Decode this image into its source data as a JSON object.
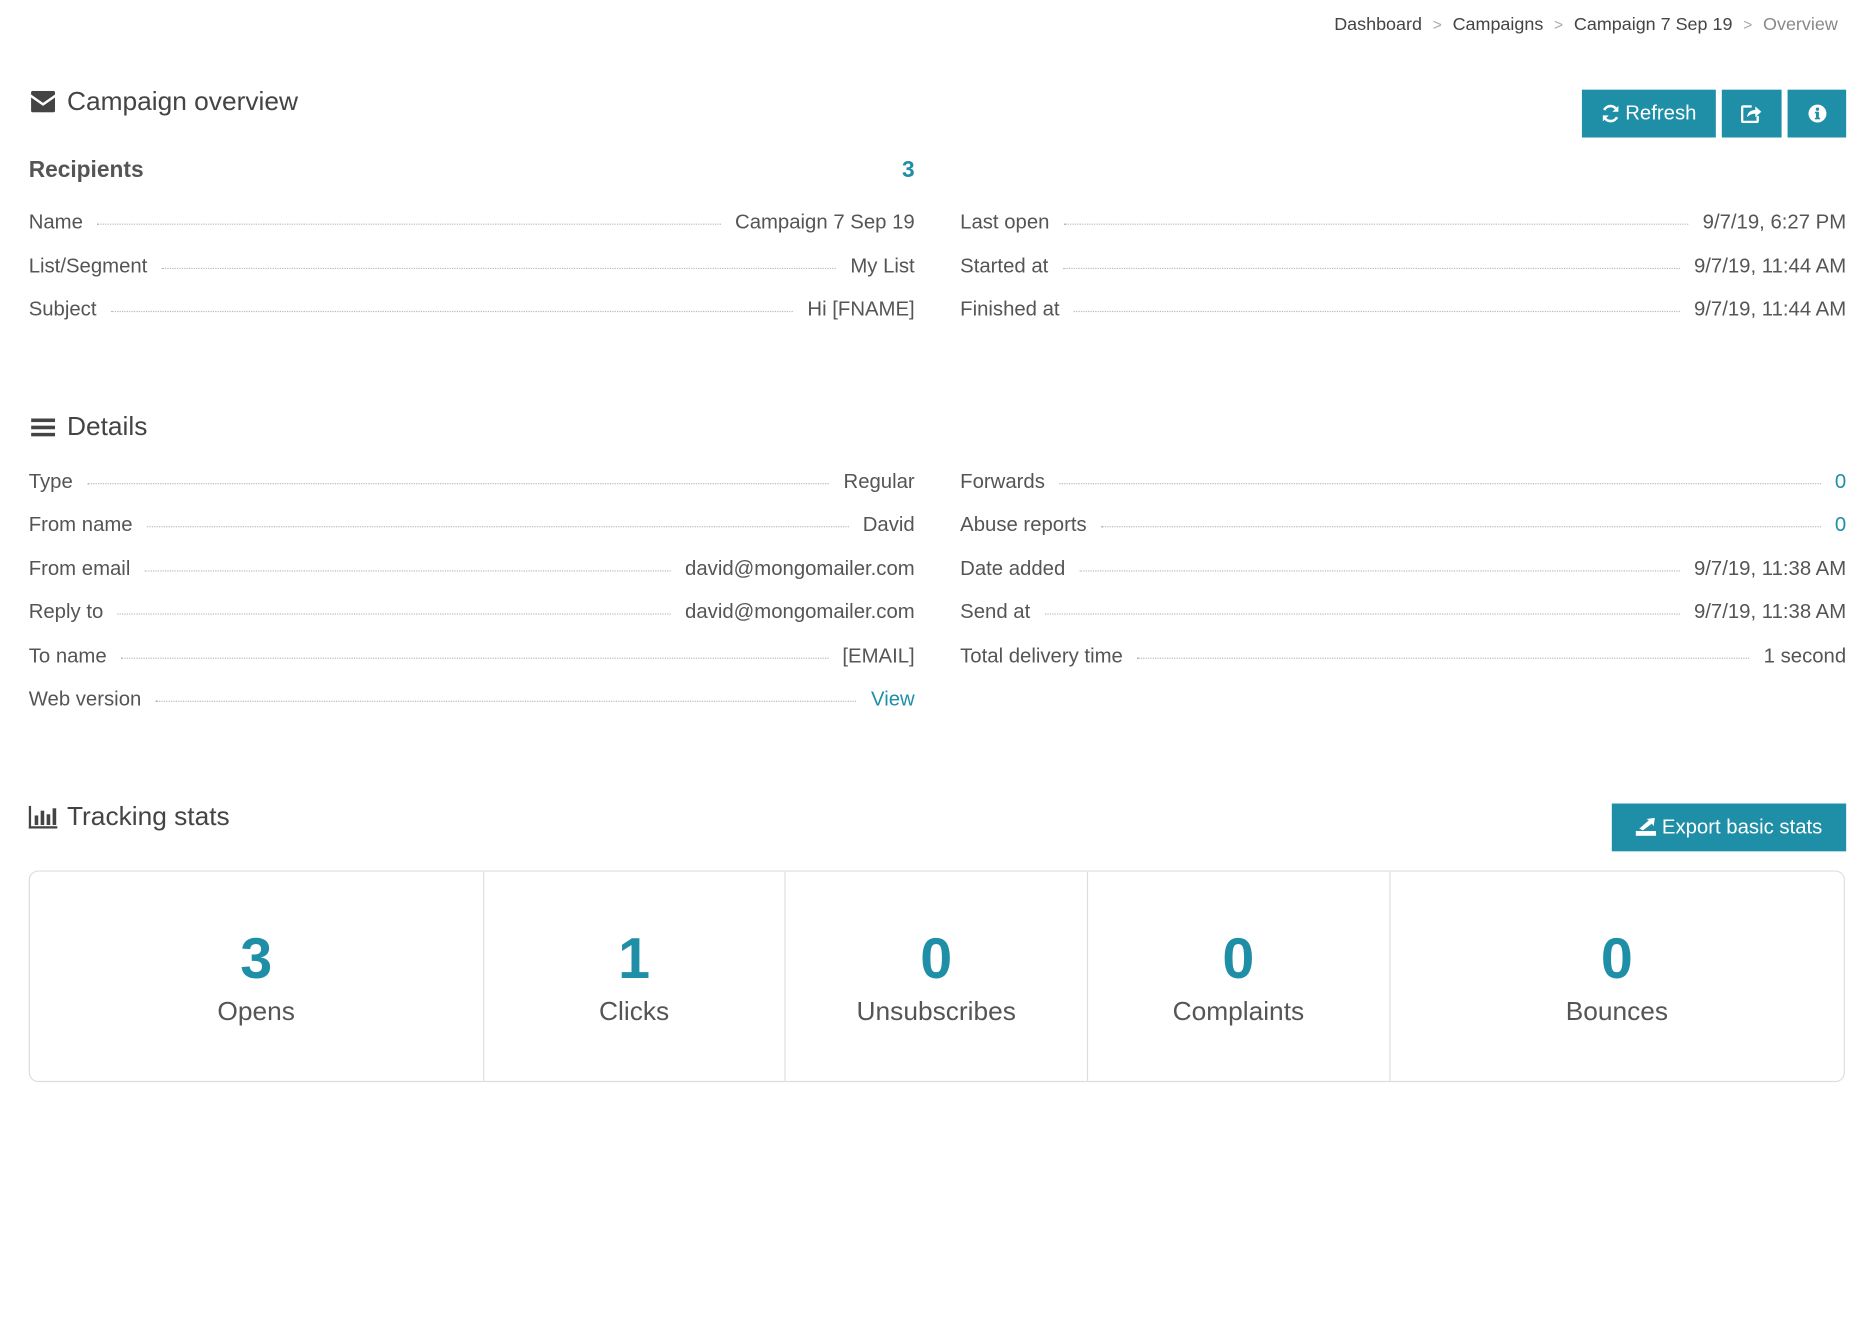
{
  "breadcrumb": {
    "items": [
      "Dashboard",
      "Campaigns",
      "Campaign 7 Sep 19"
    ],
    "current": "Overview",
    "separator": ">"
  },
  "overview": {
    "title": "Campaign overview",
    "icon": "envelope-icon",
    "refresh_label": "Refresh",
    "recipients_label": "Recipients",
    "recipients_count": "3",
    "left_rows": [
      {
        "label": "Name",
        "value": "Campaign 7 Sep 19"
      },
      {
        "label": "List/Segment",
        "value": "My List"
      },
      {
        "label": "Subject",
        "value": "Hi [FNAME]"
      }
    ],
    "right_rows": [
      {
        "label": "Last open",
        "value": "9/7/19, 6:27 PM"
      },
      {
        "label": "Started at",
        "value": "9/7/19, 11:44 AM"
      },
      {
        "label": "Finished at",
        "value": "9/7/19, 11:44 AM"
      }
    ]
  },
  "details": {
    "title": "Details",
    "icon": "list-icon",
    "left_rows": [
      {
        "label": "Type",
        "value": "Regular"
      },
      {
        "label": "From name",
        "value": "David"
      },
      {
        "label": "From email",
        "value": "david@mongomailer.com"
      },
      {
        "label": "Reply to",
        "value": "david@mongomailer.com"
      },
      {
        "label": "To name",
        "value": "[EMAIL]"
      },
      {
        "label": "Web version",
        "value": "View"
      }
    ],
    "right_rows": [
      {
        "label": "Forwards",
        "value": "0"
      },
      {
        "label": "Abuse reports",
        "value": "0"
      },
      {
        "label": "Date added",
        "value": "9/7/19, 11:38 AM"
      },
      {
        "label": "Send at",
        "value": "9/7/19, 11:38 AM"
      },
      {
        "label": "Total delivery time",
        "value": "1 second"
      }
    ]
  },
  "tracking": {
    "title": "Tracking stats",
    "icon": "bar-chart-icon",
    "export_label": "Export basic stats",
    "stats": [
      {
        "value": "3",
        "label": "Opens"
      },
      {
        "value": "1",
        "label": "Clicks"
      },
      {
        "value": "0",
        "label": "Unsubscribes"
      },
      {
        "value": "0",
        "label": "Complaints"
      },
      {
        "value": "0",
        "label": "Bounces"
      }
    ]
  },
  "colors": {
    "accent": "#1f8fa8",
    "text": "#555555",
    "border": "#dddddd"
  }
}
